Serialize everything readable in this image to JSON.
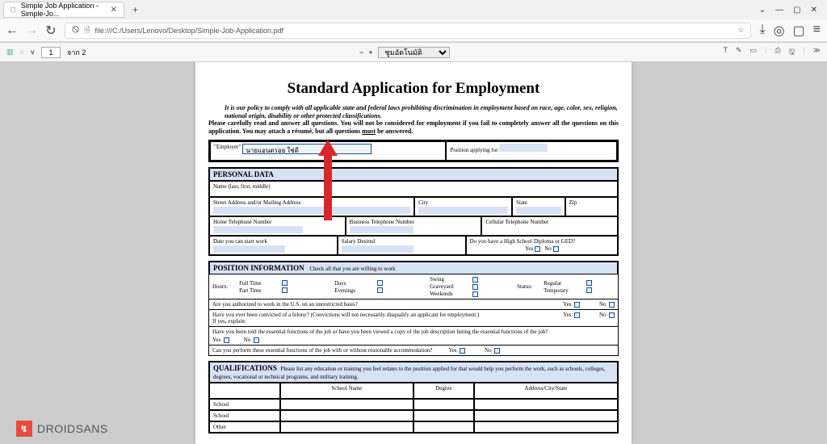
{
  "browser": {
    "tab_title": "Simple Job Application - Simple-Jo...",
    "url": "file:///C:/Users/Lenovo/Desktop/Simple-Job-Application.pdf"
  },
  "pdf_toolbar": {
    "page_current": "1",
    "page_label": "จาก 2",
    "zoom_label": "ซูมอัตโนมัติ"
  },
  "doc": {
    "title": "Standard Application for Employment",
    "policy_italic": "It is our policy to comply with all applicable state and federal laws prohibiting discrimination in employment based on race, age, color, sex, religion, national origin, disability or other protected classifications.",
    "policy_body": "Please carefully read and answer all questions. You will not be considered for employment if you fail to completely answer all the questions on this application. You may attach a résumé, but all questions ",
    "policy_must": "must",
    "policy_tail": " be answered.",
    "employer_label": "\"Employer\"",
    "employer_value": "นายแอนดรอย ใช่ดี",
    "position_label": "Position applying for",
    "personal_header": "PERSONAL DATA",
    "name_label": "Name (last, first, middle)",
    "street_label": "Street Address and/or Mailing Address",
    "city_label": "City",
    "state_label": "State",
    "zip_label": "Zip",
    "home_phone": "Home Telephone Number",
    "biz_phone": "Business Telephone Number",
    "cell_phone": "Cellular Telephone Number",
    "start_date": "Date you can start work",
    "salary": "Salary Desired",
    "diploma_q": "Do you have a High School Diploma or GED?",
    "yes": "Yes",
    "no": "No",
    "position_header": "POSITION INFORMATION",
    "position_sub": "Check all that you are willing to work",
    "hours": "Hours:",
    "full_time": "Full Time",
    "part_time": "Part Time",
    "days": "Days",
    "evenings": "Evenings",
    "swing": "Swing",
    "graveyard": "Graveyard",
    "weekends": "Weekends",
    "status": "Status:",
    "regular": "Regular",
    "temporary": "Temporary",
    "q_authorized": "Are you authorized to work in the U.S. on an unrestricted basis?",
    "q_felony": "Have you ever been convicted of a felony? (Convictions will not necessarily disqualify an applicant for employment.)",
    "q_felony_explain": "If yes, explain:",
    "q_functions": "Have you been told the essential functions of the job or have you been viewed a copy of the job description listing the essential functions of the job?",
    "q_accommodation": "Can you perform these essential functions of the job with or without reasonable accommodation?",
    "qual_header": "QUALIFICATIONS",
    "qual_sub": "Please list any education or training you feel relates to the position applied for that would help you perform the work, such as schools, colleges, degrees, vocational or technical programs, and military training.",
    "school_name": "School Name",
    "degree": "Degree",
    "address_city_state": "Address/City/State",
    "school": "School",
    "other": "Other"
  },
  "watermark": {
    "text": "DROIDSANS"
  }
}
